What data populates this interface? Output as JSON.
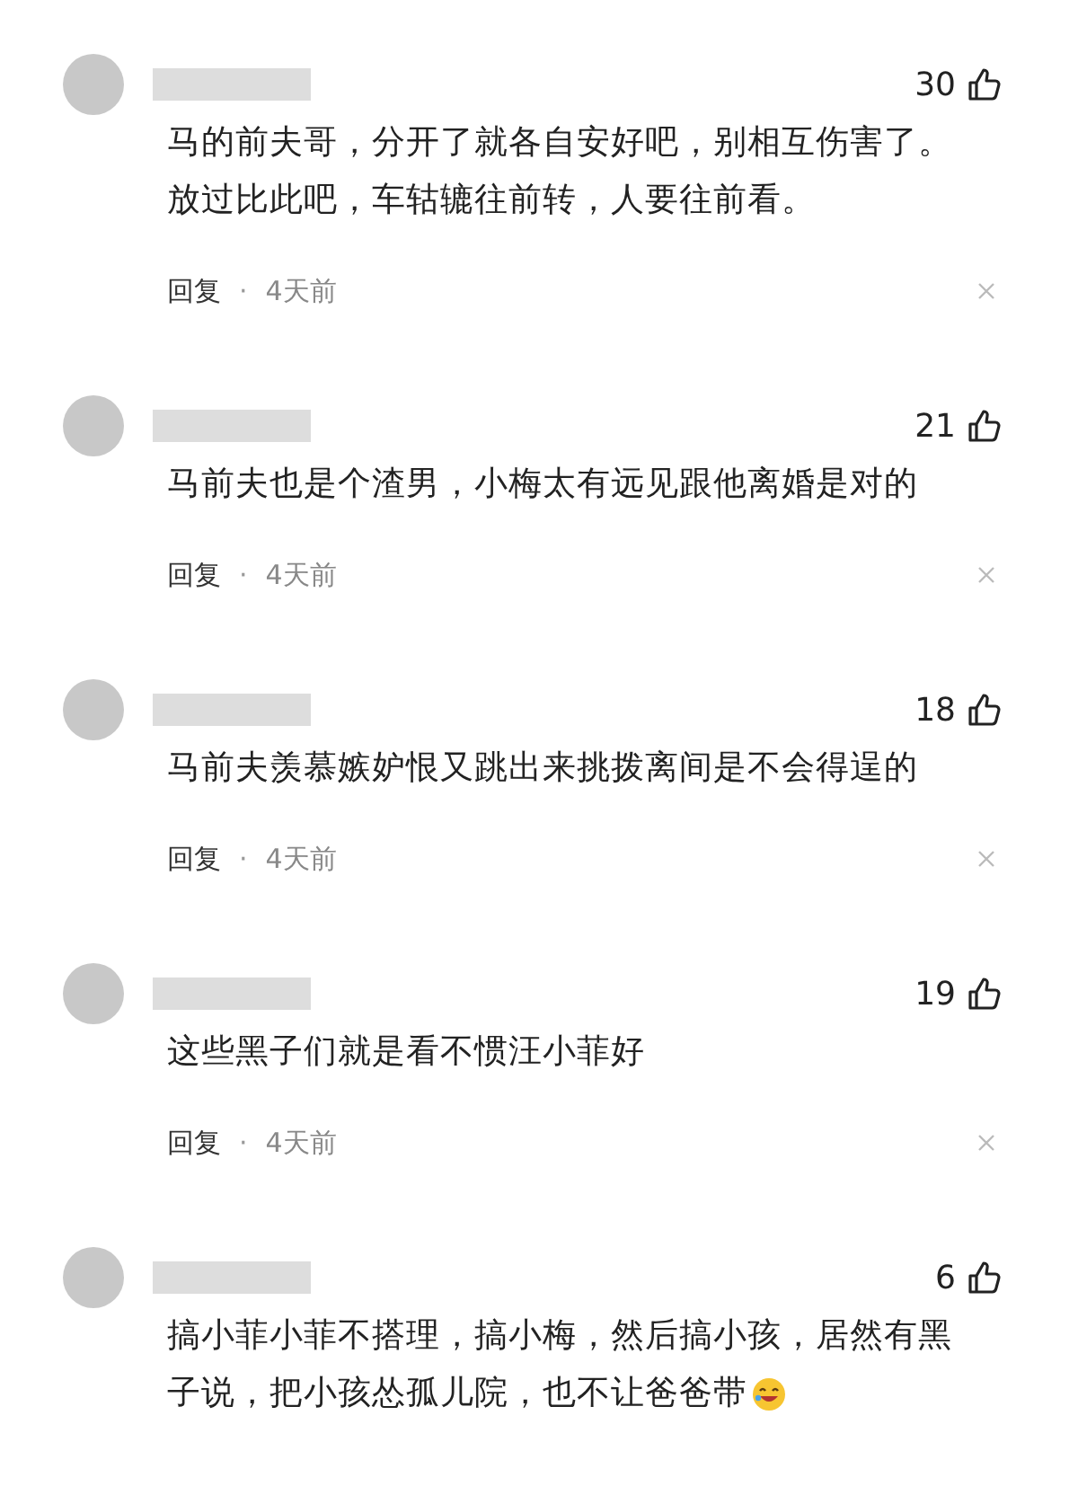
{
  "comments": [
    {
      "kind": "plain",
      "likes": "30",
      "lines": [
        "马的前夫哥，分开了就各自安好吧，别相互伤害了。",
        "放过比此吧，车轱辘往前转，人要往前看。"
      ],
      "reply": "回复",
      "dot": "·",
      "time": "4天前"
    },
    {
      "kind": "plain",
      "likes": "21",
      "lines": [
        "马前夫也是个渣男，小梅太有远见跟他离婚是对的"
      ],
      "reply": "回复",
      "dot": "·",
      "time": "4天前"
    },
    {
      "kind": "plain",
      "likes": "18",
      "lines": [
        "马前夫羡慕嫉妒恨又跳出来挑拨离间是不会得逞的"
      ],
      "reply": "回复",
      "dot": "·",
      "time": "4天前"
    },
    {
      "kind": "plain",
      "likes": "19",
      "lines": [
        "这些黑子们就是看不惯汪小菲好"
      ],
      "reply": "回复",
      "dot": "·",
      "time": "4天前"
    },
    {
      "kind": "emoji_end",
      "likes": "6",
      "lines": [
        "搞小菲小菲不搭理，搞小梅，然后搞小孩，居然有黑",
        "子说，把小孩怂孤儿院，也不让爸爸带"
      ]
    }
  ]
}
